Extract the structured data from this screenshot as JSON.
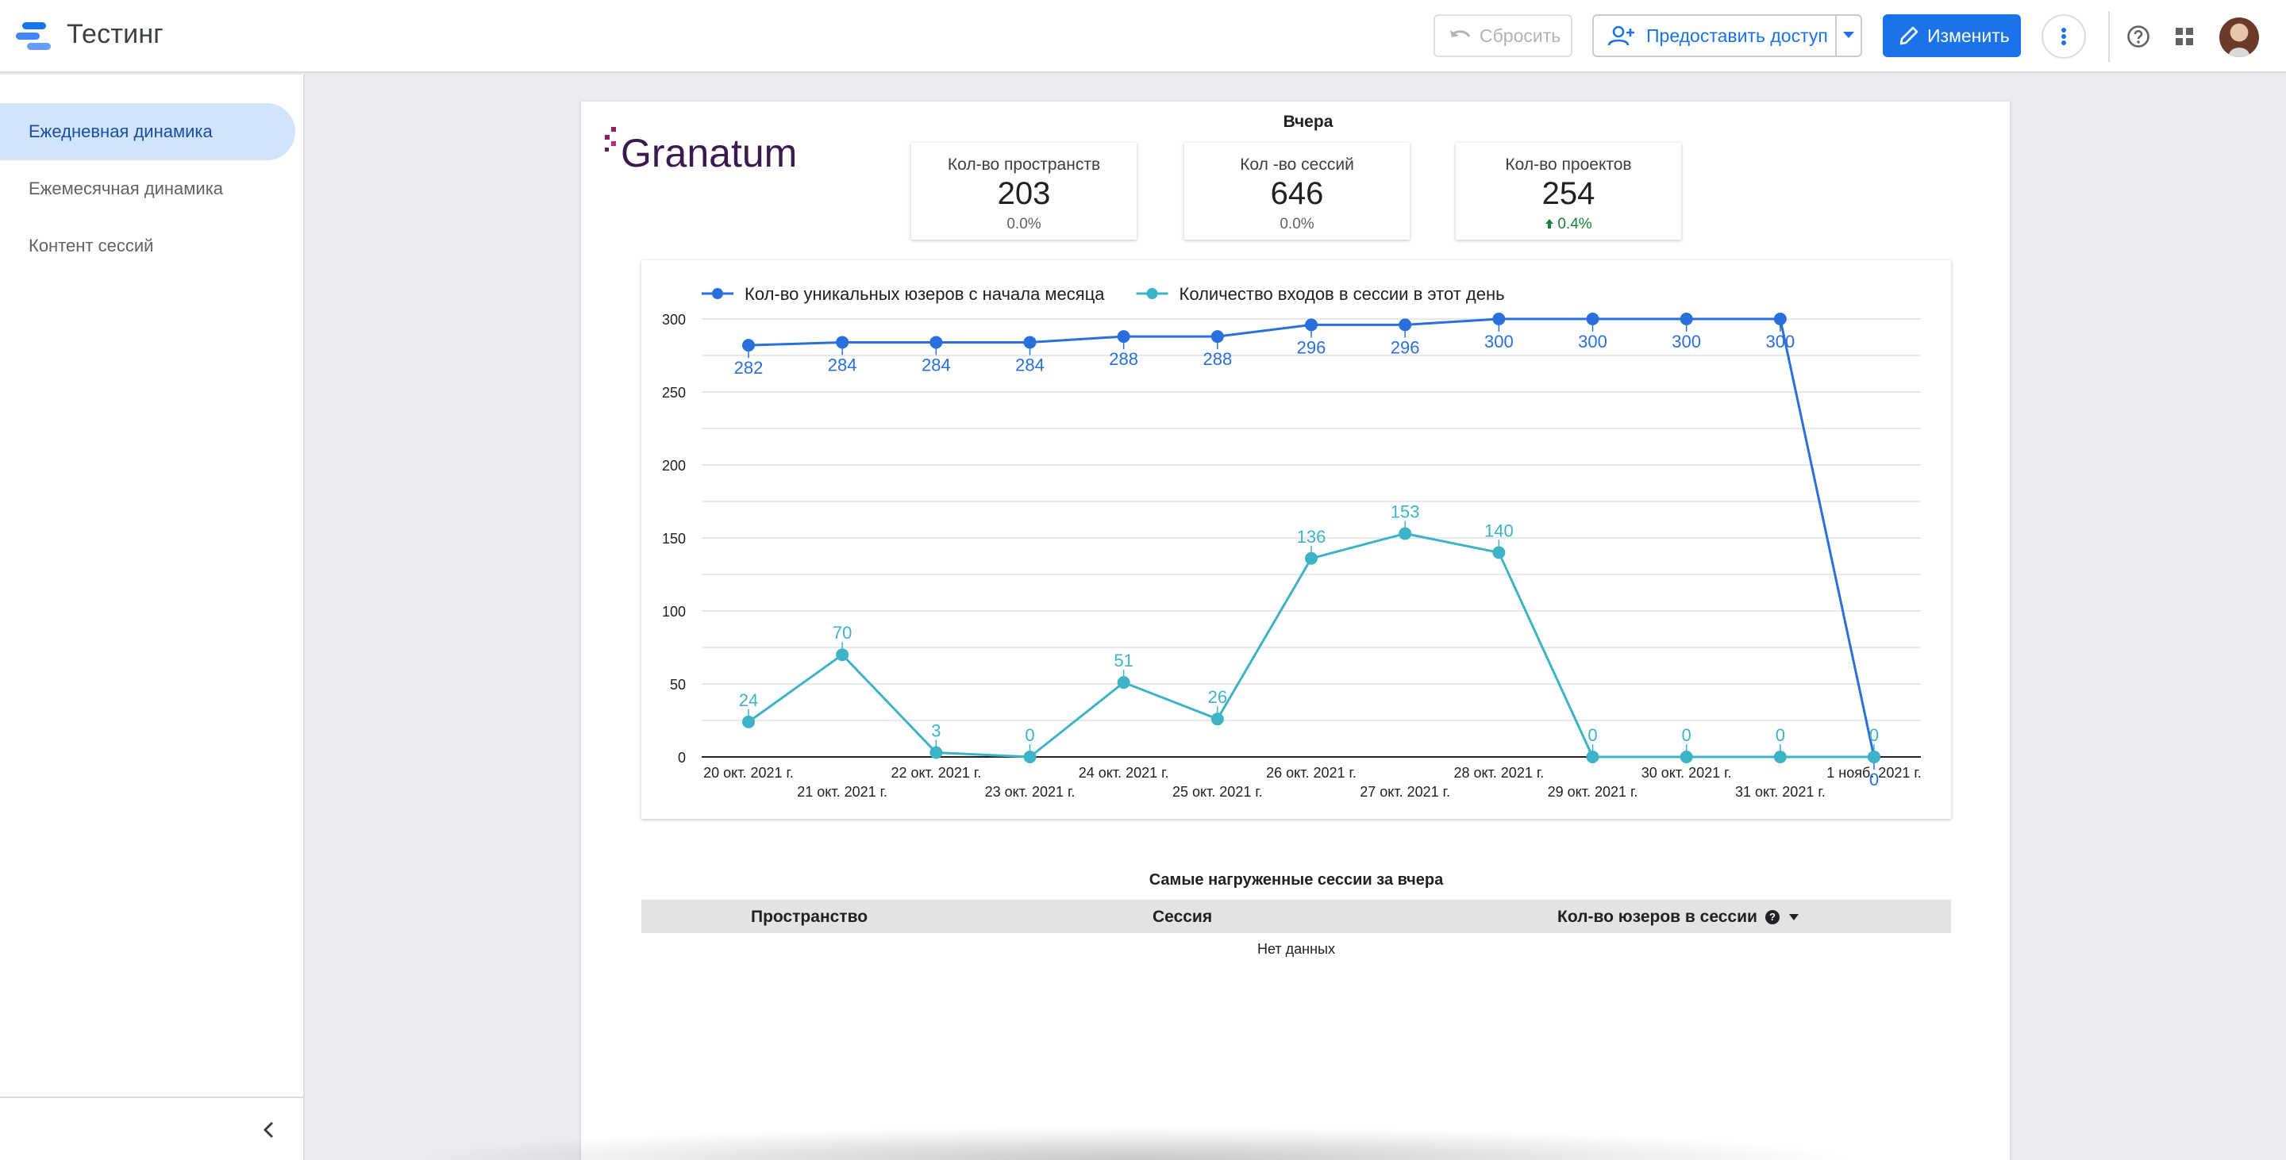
{
  "app": {
    "title": "Тестинг"
  },
  "toolbar": {
    "reset_label": "Сбросить",
    "share_label": "Предоставить доступ",
    "edit_label": "Изменить",
    "accent": "#1a73e8"
  },
  "sidebar": {
    "items": [
      {
        "label": "Ежедневная динамика",
        "active": true
      },
      {
        "label": "Ежемесячная динамика",
        "active": false
      },
      {
        "label": "Контент сессий",
        "active": false
      }
    ]
  },
  "report": {
    "caption": "Вчера",
    "logo_text": "Granatum",
    "kpis": [
      {
        "label": "Кол-во пространств",
        "value": "203",
        "delta": "0.0%",
        "trend": "none"
      },
      {
        "label": "Кол -во сессий",
        "value": "646",
        "delta": "0.0%",
        "trend": "none"
      },
      {
        "label": "Кол-во проектов",
        "value": "254",
        "delta": "0.4%",
        "trend": "up"
      }
    ],
    "table": {
      "title": "Самые нагруженные сессии за вчера",
      "columns": [
        "Пространство",
        "Сессия",
        "Кол-во юзеров в сессии"
      ],
      "sorted_column": "Кол-во юзеров в сессии",
      "empty_text": "Нет данных"
    }
  },
  "chart_data": {
    "type": "line",
    "categories": [
      "20 окт. 2021 г.",
      "21 окт. 2021 г.",
      "22 окт. 2021 г.",
      "23 окт. 2021 г.",
      "24 окт. 2021 г.",
      "25 окт. 2021 г.",
      "26 окт. 2021 г.",
      "27 окт. 2021 г.",
      "28 окт. 2021 г.",
      "29 окт. 2021 г.",
      "30 окт. 2021 г.",
      "31 окт. 2021 г.",
      "1 нояб. 2021 г."
    ],
    "series": [
      {
        "name": "Кол-во уникальных юзеров с начала месяца",
        "color": "#2a6fdb",
        "values": [
          282,
          284,
          284,
          284,
          288,
          288,
          296,
          296,
          300,
          300,
          300,
          300,
          0
        ],
        "label_position": "below"
      },
      {
        "name": "Количество входов в сессии в этот день",
        "color": "#3db3c8",
        "values": [
          24,
          70,
          3,
          0,
          51,
          26,
          136,
          153,
          140,
          0,
          0,
          0,
          0
        ],
        "label_position": "above"
      }
    ],
    "yticks": [
      0,
      50,
      100,
      150,
      200,
      250,
      300
    ],
    "ylim": [
      0,
      300
    ],
    "grid": true,
    "legend": "top-left",
    "title": "",
    "xlabel": "",
    "ylabel": ""
  }
}
